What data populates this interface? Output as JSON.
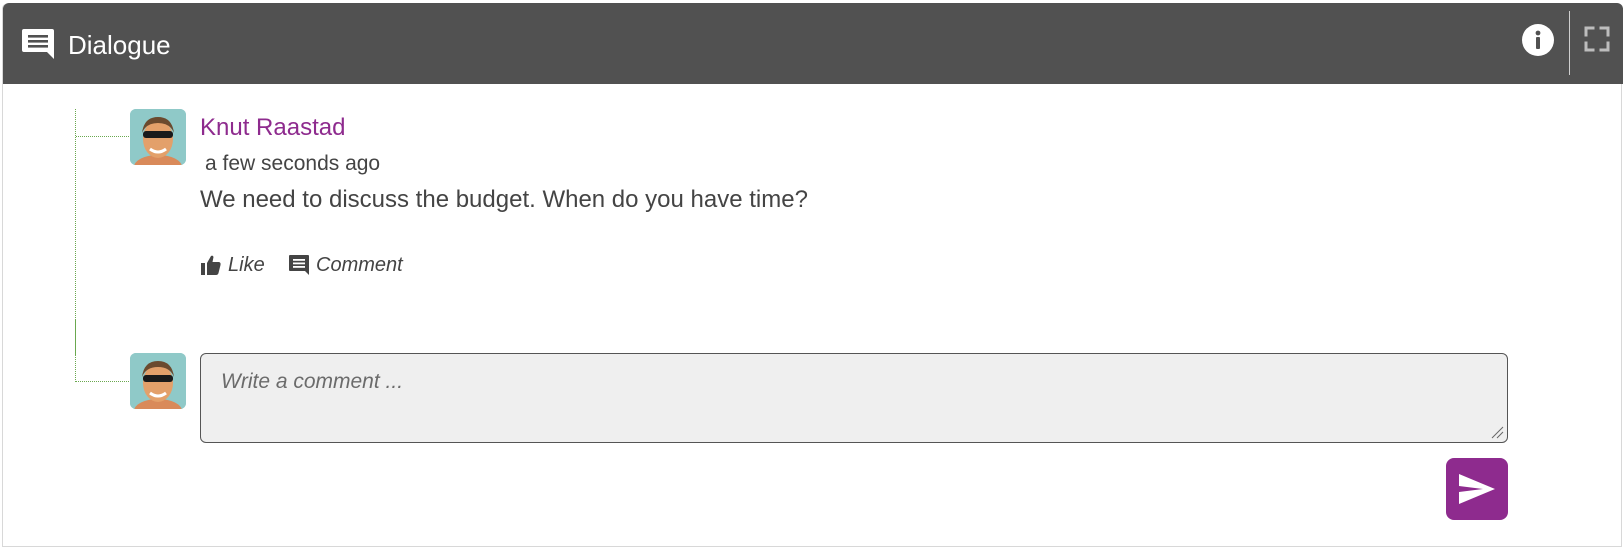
{
  "header": {
    "title": "Dialogue",
    "icon": "chat-bubble-icon",
    "info_icon": "info-icon",
    "fullscreen_icon": "fullscreen-icon"
  },
  "post": {
    "author": "Knut Raastad",
    "timestamp": "a few seconds ago",
    "message": "We need to discuss the budget. When do you have time?",
    "actions": {
      "like_label": "Like",
      "comment_label": "Comment"
    }
  },
  "comment_form": {
    "placeholder": "Write a comment ...",
    "value": "",
    "send_icon": "send-icon"
  },
  "colors": {
    "header_bg": "#515151",
    "accent": "#8e2b8e",
    "thread_line": "#6aa84f"
  }
}
